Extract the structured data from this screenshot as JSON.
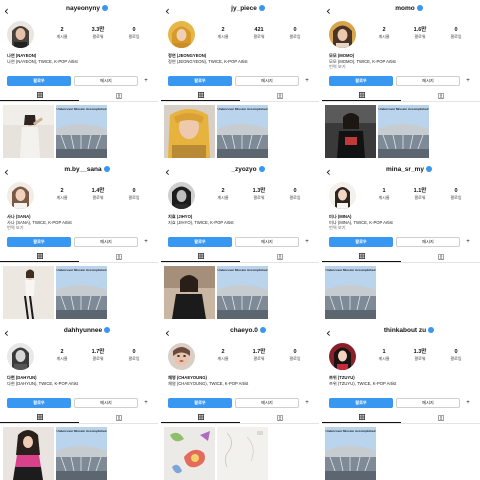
{
  "common": {
    "back_icon": "chevron-left-icon",
    "follow_label": "팔로우",
    "message_label": "메시지",
    "add_user_icon": "add-person-icon",
    "tab_grid_icon": "grid-icon",
    "tab_tagged_icon": "tagged-person-icon",
    "verified_color": "#3897f0",
    "accent": "#3897f0"
  },
  "profiles": [
    {
      "username": "nayeonyny",
      "stats": [
        {
          "num": "2",
          "label": "게시물"
        },
        {
          "num": "3.3만",
          "label": "팔로워"
        },
        {
          "num": "0",
          "label": "팔로잉"
        }
      ],
      "bio_name": "나연 (NAYEON)",
      "bio_line": "나연 (NAYEON), TWICE, K-POP Artist",
      "bio_more": "",
      "follow_label": "팔로우",
      "post_banner": "Undercover Mission Accomplished",
      "post_count": 2
    },
    {
      "username": "jy_piece",
      "stats": [
        {
          "num": "2",
          "label": "게시물"
        },
        {
          "num": "421",
          "label": "팔로워"
        },
        {
          "num": "0",
          "label": "팔로잉"
        }
      ],
      "bio_name": "정연 (JEONGYEON)",
      "bio_line": "정연 (JEONGYEON), TWICE, K-POP Artist",
      "bio_more": "",
      "follow_label": "팔로우",
      "post_banner": "Undercover Mission Accomplished",
      "post_count": 2
    },
    {
      "username": "momo",
      "stats": [
        {
          "num": "2",
          "label": "게시물"
        },
        {
          "num": "1.6만",
          "label": "팔로워"
        },
        {
          "num": "0",
          "label": "팔로잉"
        }
      ],
      "bio_name": "모모 (MOMO)",
      "bio_line": "모모 (MOMO), TWICE, K-POP Artist",
      "bio_more": "번역 보기",
      "follow_label": "팔로우",
      "post_banner": "Undercover Mission Accomplished",
      "post_count": 2
    },
    {
      "username": "m.by__sana",
      "stats": [
        {
          "num": "2",
          "label": "게시물"
        },
        {
          "num": "1.4만",
          "label": "팔로워"
        },
        {
          "num": "0",
          "label": "팔로잉"
        }
      ],
      "bio_name": "사나 (SANA)",
      "bio_line": "사나 (SANA), TWICE, K-POP Artist",
      "bio_more": "번역 보기",
      "follow_label": "팔로우",
      "post_banner": "Undercover Mission Accomplished",
      "post_count": 2
    },
    {
      "username": "_zyozyo",
      "stats": [
        {
          "num": "2",
          "label": "게시물"
        },
        {
          "num": "1.3만",
          "label": "팔로워"
        },
        {
          "num": "0",
          "label": "팔로잉"
        }
      ],
      "bio_name": "지효 (JIHYO)",
      "bio_line": "지효 (JIHYO), TWICE, K-POP Artist",
      "bio_more": "",
      "follow_label": "팔로우",
      "post_banner": "Undercover Mission Accomplished",
      "post_count": 2
    },
    {
      "username": "mina_sr_my",
      "stats": [
        {
          "num": "1",
          "label": "게시물"
        },
        {
          "num": "1.1만",
          "label": "팔로워"
        },
        {
          "num": "0",
          "label": "팔로잉"
        }
      ],
      "bio_name": "미나 (MINA)",
      "bio_line": "미나 (MINA), TWICE, K-POP Artist",
      "bio_more": "번역 보기",
      "follow_label": "팔로우",
      "post_banner": "Undercover Mission Accomplished",
      "post_count": 1
    },
    {
      "username": "dahhyunnee",
      "stats": [
        {
          "num": "2",
          "label": "게시물"
        },
        {
          "num": "1.7만",
          "label": "팔로워"
        },
        {
          "num": "0",
          "label": "팔로잉"
        }
      ],
      "bio_name": "다현 (DAHYUN)",
      "bio_line": "다현 (DAHYUN), TWICE, K-POP Artist",
      "bio_more": "",
      "follow_label": "팔로우",
      "post_banner": "Undercover Mission Accomplished",
      "post_count": 2
    },
    {
      "username": "chaeyo.0",
      "stats": [
        {
          "num": "2",
          "label": "게시물"
        },
        {
          "num": "1.7만",
          "label": "팔로워"
        },
        {
          "num": "0",
          "label": "팔로잉"
        }
      ],
      "bio_name": "채영 (CHAEYOUNG)",
      "bio_line": "채영 (CHAEYOUNG), TWICE, K-POP Artist",
      "bio_more": "",
      "follow_label": "팔로우",
      "post_banner": "",
      "post_count": 2
    },
    {
      "username": "thinkabout zu",
      "stats": [
        {
          "num": "1",
          "label": "게시물"
        },
        {
          "num": "1.3만",
          "label": "팔로워"
        },
        {
          "num": "0",
          "label": "팔로잉"
        }
      ],
      "bio_name": "쯔위 (TZUYU)",
      "bio_line": "쯔위 (TZUYU), TWICE, K-POP Artist",
      "bio_more": "",
      "follow_label": "팔로우",
      "post_banner": "Undercover Mission Accomplished",
      "post_count": 1
    }
  ]
}
